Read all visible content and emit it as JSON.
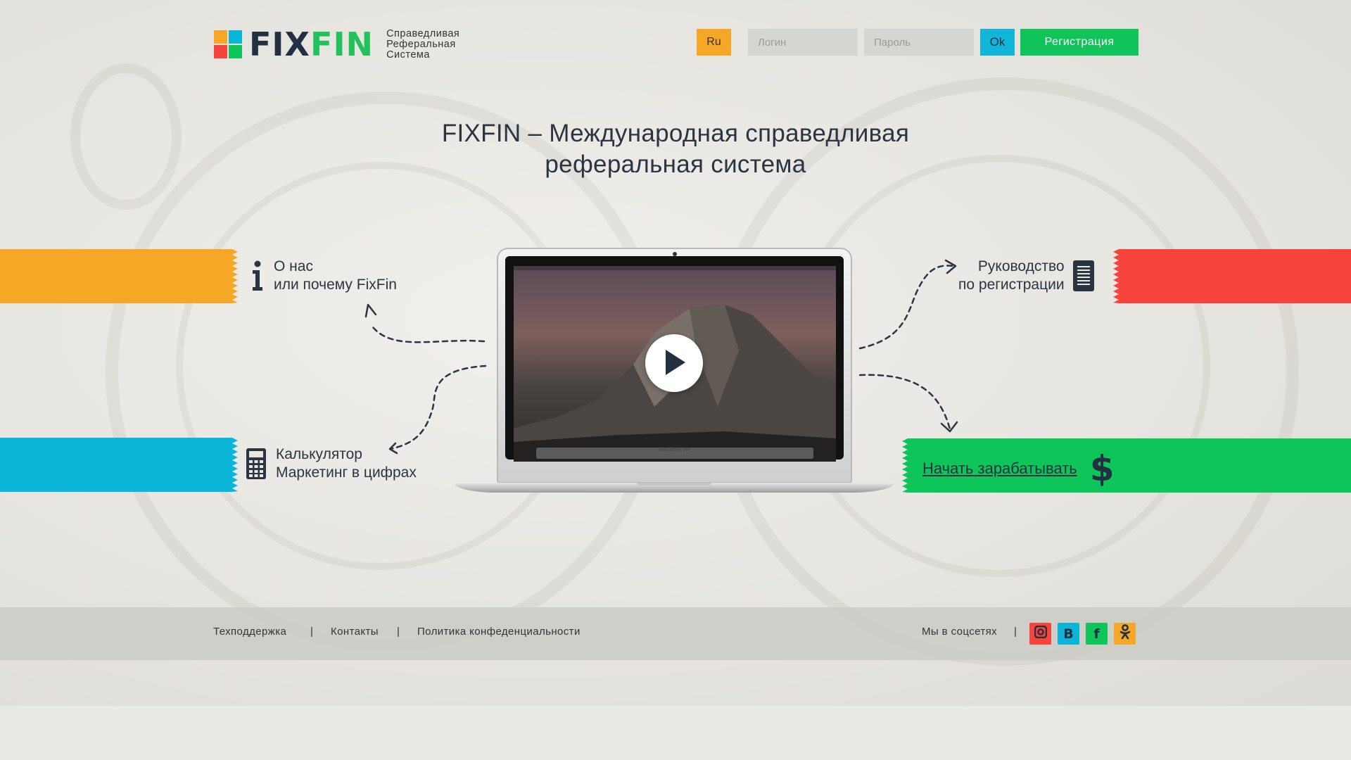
{
  "header": {
    "logo_fix": "FIX",
    "logo_fin": "FIN",
    "tagline": [
      "Справедливая",
      "Реферальная",
      "Система"
    ],
    "lang": "Ru",
    "login_placeholder": "Логин",
    "password_placeholder": "Пароль",
    "ok_label": "Ok",
    "register_label": "Регистрация",
    "logo_colors": [
      "#f6a725",
      "#0ab5d8",
      "#f6433c",
      "#10c45a"
    ]
  },
  "hero": {
    "title_line1": "FIXFIN – Международная справедливая",
    "title_line2": "реферальная система"
  },
  "features": {
    "about": {
      "line1": "О нас",
      "line2": "или почему FixFin",
      "icon": "info-icon"
    },
    "calculator": {
      "line1": "Калькулятор",
      "line2": "Маркетинг в цифрах",
      "icon": "calculator-icon"
    },
    "guide": {
      "line1": "Руководство",
      "line2": "по регистрации",
      "icon": "document-icon"
    },
    "earn": {
      "label": "Начать зарабатывать",
      "icon": "dollar-icon",
      "symbol": "$"
    }
  },
  "video": {
    "laptop_label": "MacBook Air",
    "play_icon": "play-icon"
  },
  "colors": {
    "orange": "#f6a725",
    "blue": "#0ab5d8",
    "red": "#f6433c",
    "green": "#0ec55a",
    "dark": "#233041"
  },
  "footer": {
    "links": [
      "Техподдержка",
      "Контакты",
      "Политика конфеденциальности"
    ],
    "separator": "|",
    "social_label": "Мы в соцсетях",
    "social": [
      {
        "name": "instagram",
        "glyph": "◘",
        "color": "#f6433c"
      },
      {
        "name": "vk",
        "glyph": "В",
        "color": "#0ab5d8"
      },
      {
        "name": "facebook",
        "glyph": "f",
        "color": "#0ec55a"
      },
      {
        "name": "odnoklassniki",
        "glyph": "ok",
        "color": "#f6a725"
      }
    ]
  }
}
